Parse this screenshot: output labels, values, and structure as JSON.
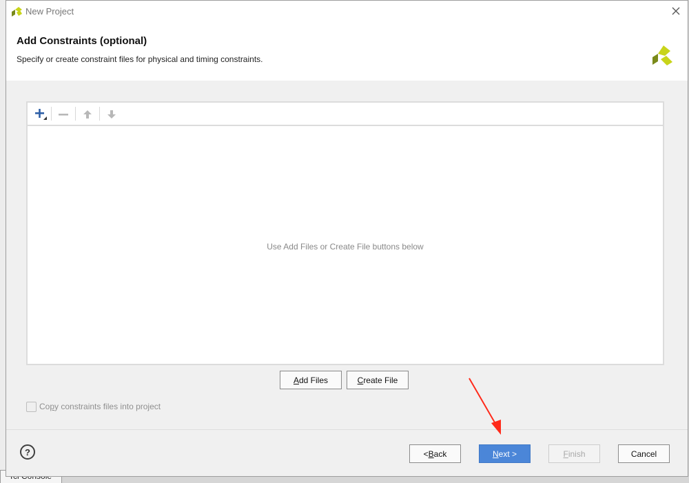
{
  "window": {
    "title": "New Project"
  },
  "background": {
    "tab_label": "Tcl Console"
  },
  "header": {
    "title": "Add Constraints (optional)",
    "subtitle": "Specify or create constraint files for physical and timing constraints."
  },
  "panel": {
    "empty_message": "Use Add Files or Create File buttons below"
  },
  "toolbar": {
    "icons": [
      "add-icon",
      "remove-icon",
      "move-up-icon",
      "move-down-icon"
    ]
  },
  "actions": {
    "add_files": {
      "mnemonic": "A",
      "rest": "dd Files"
    },
    "create_file": {
      "mnemonic": "C",
      "rest": "reate File"
    }
  },
  "copy_option": {
    "prefix": "Co",
    "mnemonic": "p",
    "rest": "y constraints files into project",
    "checked": false
  },
  "footer": {
    "help": "?",
    "back": {
      "prefix": "< ",
      "mnemonic": "B",
      "rest": "ack"
    },
    "next": {
      "mnemonic": "N",
      "rest": "ext >"
    },
    "finish": {
      "mnemonic": "F",
      "rest": "inish"
    },
    "cancel": "Cancel"
  },
  "colors": {
    "accent": "#4b86d8",
    "logo_light": "#c8d41a",
    "logo_dark": "#7a8a1a",
    "annotation": "#ff2a1a"
  }
}
